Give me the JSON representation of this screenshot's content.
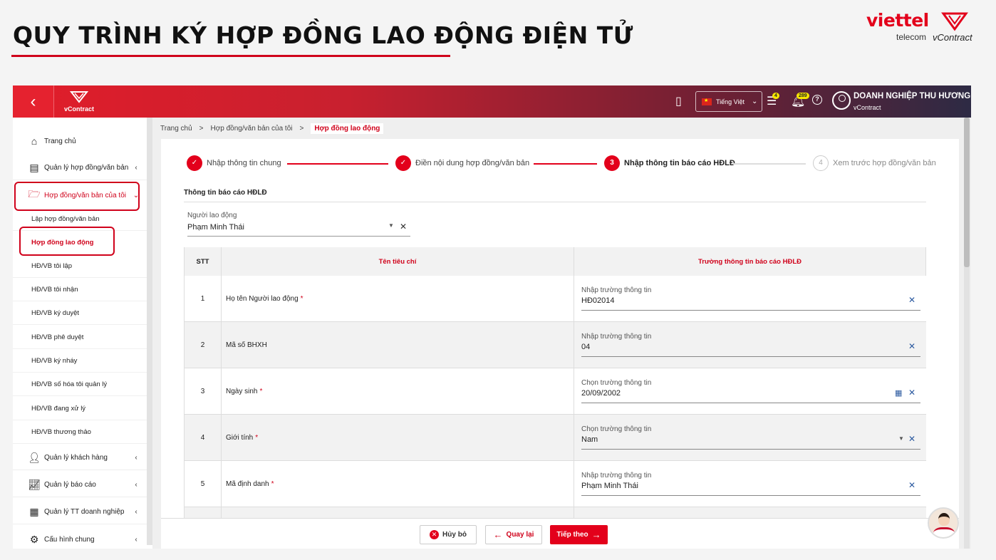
{
  "slide": {
    "title": "QUY TRÌNH KÝ HỢP ĐỒNG LAO ĐỘNG ĐIỆN TỬ",
    "brand_name": "viettel",
    "brand_sub": "telecom",
    "product": "vContract"
  },
  "topbar": {
    "logo_text": "vContract",
    "language": "Tiếng Việt",
    "doc_badge": "4",
    "notif_badge": "289",
    "user_name": "DOANH NGHIỆP THU HƯƠNG",
    "user_sub": "vContract"
  },
  "sidebar": {
    "home": "Trang chủ",
    "manage_docs": "Quản lý hợp đồng/văn bản",
    "my_docs": "Hợp đồng/văn bản của tôi",
    "sub": [
      "Lập hợp đồng/văn bản",
      "Hợp đồng lao động",
      "HĐ/VB tôi lập",
      "HĐ/VB tôi nhận",
      "HĐ/VB ký duyệt",
      "HĐ/VB phê duyệt",
      "HĐ/VB ký nháy",
      "HĐ/VB số hóa tôi quản lý",
      "HĐ/VB đang xử lý",
      "HĐ/VB thương thảo"
    ],
    "customers": "Quản lý khách hàng",
    "reports": "Quản lý báo cáo",
    "company": "Quản lý TT doanh nghiệp",
    "settings": "Cấu hình chung"
  },
  "breadcrumb": [
    "Trang chủ",
    "Hợp đồng/văn bản của tôi",
    "Hợp đồng lao động"
  ],
  "breadcrumb_sep": ">",
  "steps": [
    {
      "num": "✓",
      "label": "Nhập thông tin chung"
    },
    {
      "num": "✓",
      "label": "Điền nội dung hợp đồng/văn bản"
    },
    {
      "num": "3",
      "label": "Nhập thông tin báo cáo HĐLĐ"
    },
    {
      "num": "4",
      "label": "Xem trước hợp đồng/văn bản"
    }
  ],
  "section_title": "Thông tin báo cáo HĐLĐ",
  "employee": {
    "label": "Người lao động",
    "value": "Phạm Minh Thái"
  },
  "table": {
    "headers": [
      "STT",
      "Tên tiêu chí",
      "Trường thông tin báo cáo HĐLĐ"
    ],
    "rows": [
      {
        "stt": "1",
        "name": "Họ tên Người lao động",
        "required": "*",
        "field_label": "Nhập trường thông tin",
        "value": "HĐ02014"
      },
      {
        "stt": "2",
        "name": "Mã số BHXH",
        "required": "",
        "field_label": "Nhập trường thông tin",
        "value": "04"
      },
      {
        "stt": "3",
        "name": "Ngày sinh",
        "required": "*",
        "field_label": "Chọn trường thông tin",
        "value": "20/09/2002"
      },
      {
        "stt": "4",
        "name": "Giới tính",
        "required": "*",
        "field_label": "Chọn trường thông tin",
        "value": "Nam"
      },
      {
        "stt": "5",
        "name": "Mã định danh",
        "required": "*",
        "field_label": "Nhập trường thông tin",
        "value": "Phạm Minh Thái"
      }
    ]
  },
  "buttons": {
    "cancel": "Hủy bỏ",
    "back": "Quay lại",
    "next": "Tiếp theo"
  },
  "colors": {
    "accent": "#e3001b",
    "dark": "#2d2a44",
    "link": "#2c5aa0"
  }
}
